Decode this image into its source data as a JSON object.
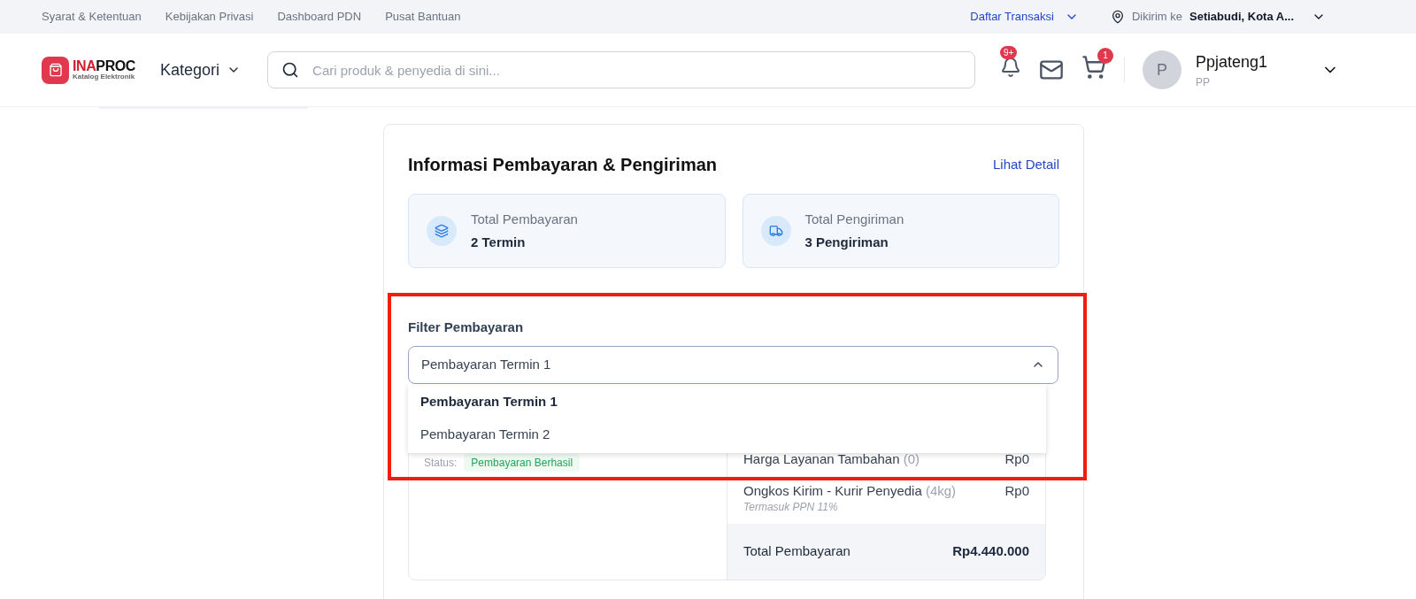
{
  "top_links": [
    "Syarat & Ketentuan",
    "Kebijakan Privasi",
    "Dashboard PDN",
    "Pusat Bantuan"
  ],
  "transactions_menu": "Daftar Transaksi",
  "delivery": {
    "label": "Dikirim ke",
    "location": "Setiabudi, Kota A..."
  },
  "logo": {
    "name_red": "INA",
    "name_dark": "PROC",
    "tagline": "Katalog Elektronik"
  },
  "category_menu": "Kategori",
  "search": {
    "placeholder": "Cari produk & penyedia di sini..."
  },
  "notifications_badge": "9+",
  "cart_badge": "1",
  "user": {
    "initial": "P",
    "name": "Ppjateng1",
    "role": "PP"
  },
  "card": {
    "title": "Informasi Pembayaran & Pengiriman",
    "link": "Lihat Detail",
    "summaries": [
      {
        "kind": "payment",
        "label": "Total Pembayaran",
        "value": "2 Termin"
      },
      {
        "kind": "shipping",
        "label": "Total Pengiriman",
        "value": "3 Pengiriman"
      }
    ]
  },
  "filter": {
    "label": "Filter Pembayaran",
    "value": "Pembayaran Termin 1",
    "expanded": true,
    "highlighted": true,
    "options": [
      {
        "label": "Pembayaran Termin 1",
        "selected": true
      },
      {
        "label": "Pembayaran Termin 2",
        "selected": false
      }
    ]
  },
  "payment": {
    "status_label": "Status:",
    "status": "Pembayaran Berhasil",
    "lines": [
      {
        "label": "Harga Layanan Tambahan",
        "detail": "(0)",
        "amount": "Rp0"
      },
      {
        "label": "Ongkos Kirim - Kurir Penyedia",
        "detail": "(4kg)",
        "amount": "Rp0",
        "note": "Termasuk PPN 11%"
      }
    ],
    "total_label": "Total Pembayaran",
    "total": "Rp4.440.000"
  }
}
